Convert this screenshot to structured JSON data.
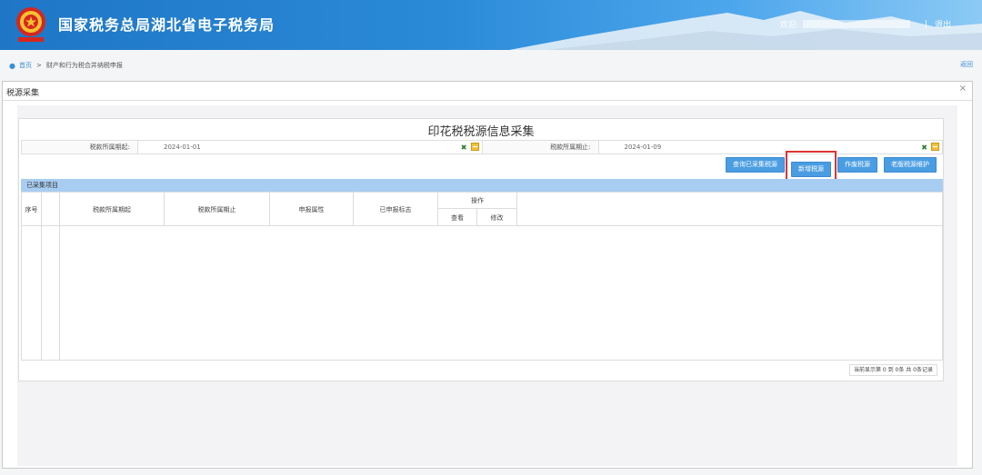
{
  "header": {
    "site_title": "国家税务总局湖北省电子税务局",
    "welcome": "欢迎:",
    "separator": "|",
    "logout": "退出"
  },
  "breadcrumb": {
    "home": "首页",
    "separator": ">",
    "current": "财产和行为税合并纳税申报",
    "back": "返回"
  },
  "dialog": {
    "title": "税源采集",
    "close": "×"
  },
  "form": {
    "title": "印花税税源信息采集",
    "start_label": "税款所属期起:",
    "start_value": "2024-01-01",
    "end_label": "税款所属期止:",
    "end_value": "2024-01-09"
  },
  "toolbar": {
    "query_collected": "查询已采集税源",
    "add_source": "新增税源",
    "void_source": "作废税源",
    "old_source_maintain": "老版税源维护"
  },
  "section": {
    "collected_title": "已采集项目"
  },
  "table": {
    "headers": {
      "seq": "序号",
      "period_start": "税款所属期起",
      "period_end": "税款所属期止",
      "declare_attr": "申报属性",
      "declared_flag": "已申报标志",
      "operation": "操作",
      "view": "查看",
      "modify": "修改"
    }
  },
  "pagination": {
    "text": "当前显示第  0 到  0条 共  0条记录"
  },
  "colors": {
    "header_blue": "#1f76c6",
    "button_blue": "#4a9de2",
    "section_blue": "#a8cdf2",
    "highlight_red": "#dd3333"
  }
}
